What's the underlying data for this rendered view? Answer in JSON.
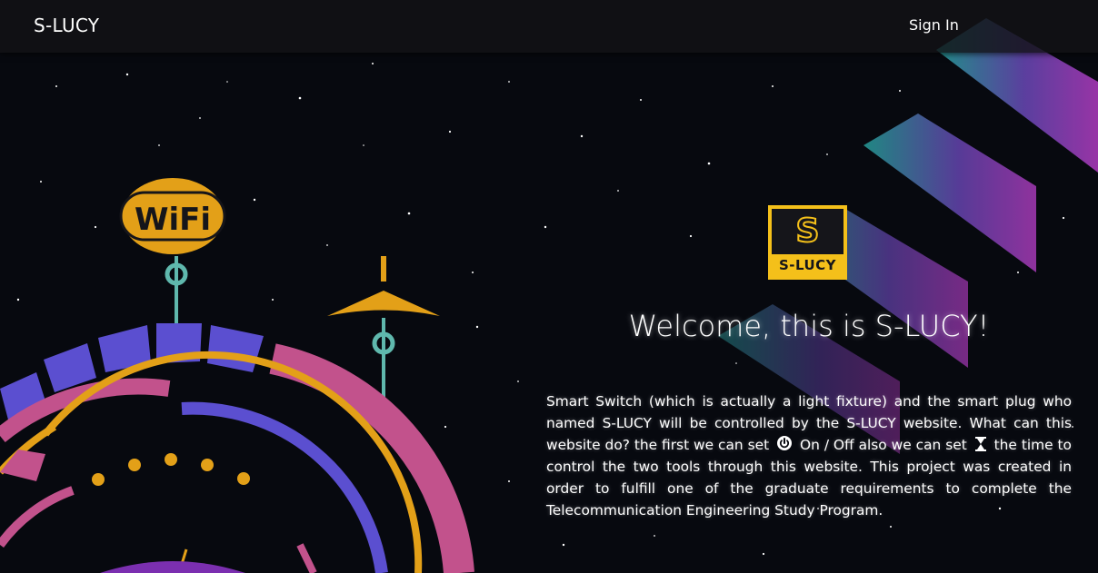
{
  "nav": {
    "brand": "S-LUCY",
    "sign_in": "Sign In"
  },
  "logo": {
    "letter": "S",
    "text": "S-LUCY",
    "icon": "s-lucy-logo"
  },
  "hero": {
    "title": "Welcome, this is S-LUCY!",
    "desc_part1": "Smart Switch (which is actually a light fixture) and the smart plug who named S-LUCY will be controlled by the S-LUCY website. What can this website do? the first we can set",
    "power_icon": "power-icon",
    "desc_part2": "On / Off also we can set",
    "timer_icon": "hourglass-icon",
    "desc_part3": "the time to control the two tools through this website. This project was created in order to fulfill one of the graduate requirements to complete the Telecommunication Engineering Study Program."
  },
  "illustration": {
    "wifi_text": "WiFi",
    "icon": "wifi-badge-icon"
  },
  "colors": {
    "accent_yellow": "#f4c01a",
    "accent_pink": "#c2528c",
    "accent_purple": "#5b4fd0",
    "accent_teal": "#5fb8ad"
  }
}
